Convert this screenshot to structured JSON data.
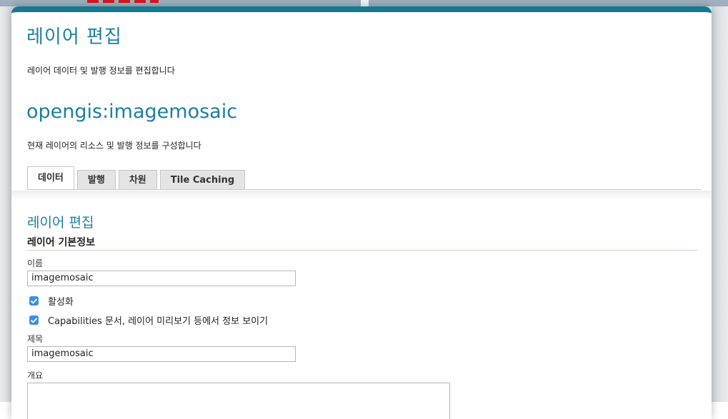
{
  "header": {
    "title": "레이어 편집",
    "description": "레이어 데이터 및 발행 정보를 편집합니다"
  },
  "layer": {
    "name": "opengis:imagemosaic",
    "description": "현재 레이어의 리소스 및 발행 정보를 구성합니다"
  },
  "tabs": [
    {
      "label": "데이터",
      "active": true
    },
    {
      "label": "발행",
      "active": false
    },
    {
      "label": "차원",
      "active": false
    },
    {
      "label": "Tile Caching",
      "active": false
    }
  ],
  "form": {
    "section_title": "레이어 편집",
    "subsection_title": "레이어 기본정보",
    "name_label": "이름",
    "name_value": "imagemosaic",
    "enabled_label": "활성화",
    "enabled_checked": true,
    "advertised_label": "Capabilities 문서, 레이어 미리보기 등에서 정보 보이기",
    "advertised_checked": true,
    "title_label": "제목",
    "title_value": "imagemosaic",
    "abstract_label": "개요",
    "abstract_value": ""
  },
  "colors": {
    "accent": "#1a7fa0",
    "panel_border": "#147a8f",
    "checkbox": "#3b8fe2",
    "highlight_dash": "#e0141b"
  }
}
